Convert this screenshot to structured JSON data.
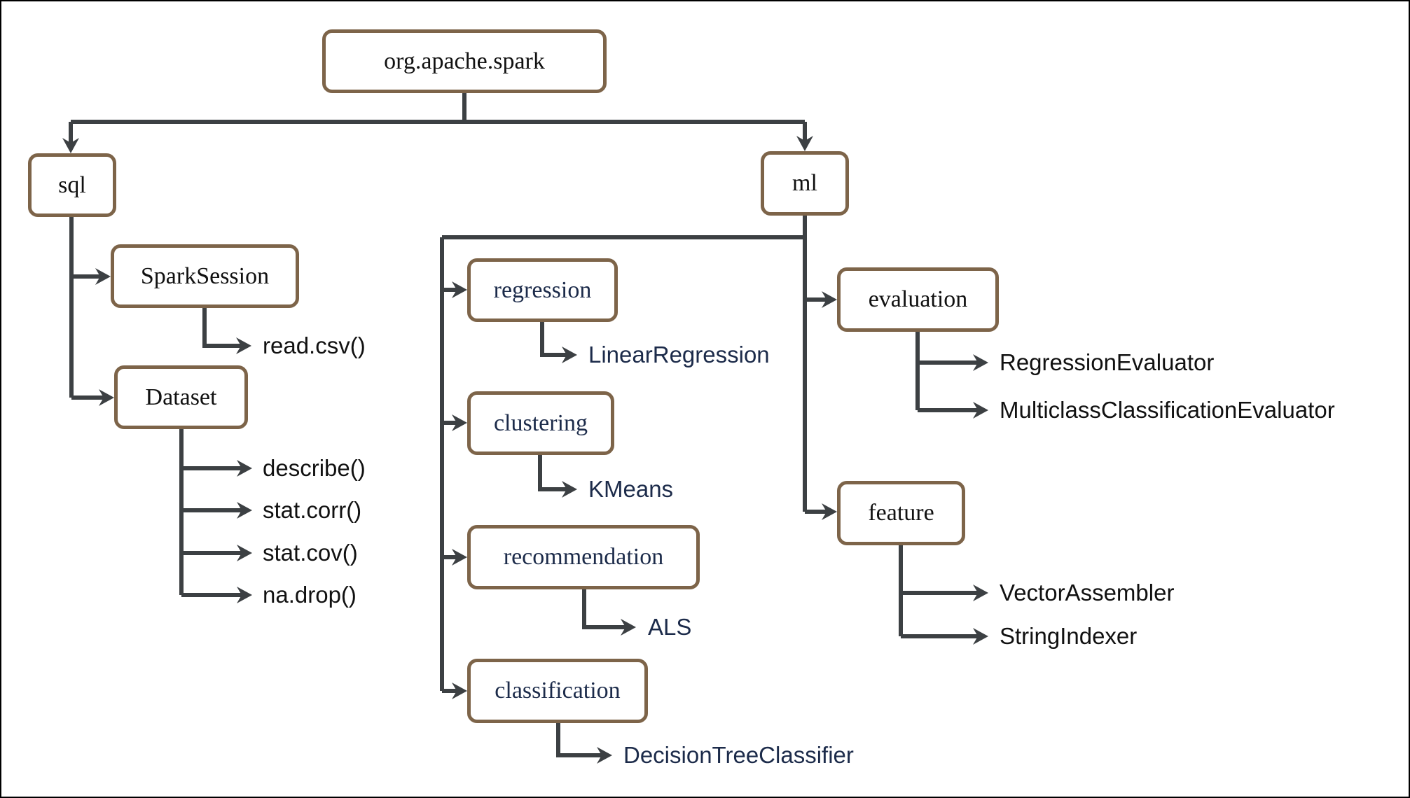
{
  "diagram": {
    "root": "org.apache.spark",
    "packages": {
      "sql": {
        "label": "sql",
        "classes": {
          "spark_session": {
            "label": "SparkSession",
            "methods": [
              "read.csv()"
            ]
          },
          "dataset": {
            "label": "Dataset",
            "methods": [
              "describe()",
              "stat.corr()",
              "stat.cov()",
              "na.drop()"
            ]
          }
        }
      },
      "ml": {
        "label": "ml",
        "subpackages": {
          "regression": {
            "label": "regression",
            "classes": [
              "LinearRegression"
            ]
          },
          "clustering": {
            "label": "clustering",
            "classes": [
              "KMeans"
            ]
          },
          "recommendation": {
            "label": "recommendation",
            "classes": [
              "ALS"
            ]
          },
          "classification": {
            "label": "classification",
            "classes": [
              "DecisionTreeClassifier"
            ]
          },
          "evaluation": {
            "label": "evaluation",
            "classes": [
              "RegressionEvaluator",
              "MulticlassClassificationEvaluator"
            ]
          },
          "feature": {
            "label": "feature",
            "classes": [
              "VectorAssembler",
              "StringIndexer"
            ]
          }
        }
      }
    }
  },
  "colors": {
    "node_border": "#7d6449",
    "connector": "#3c4043",
    "ml_subtree_text": "#1c2b4a",
    "default_text": "#111111"
  }
}
